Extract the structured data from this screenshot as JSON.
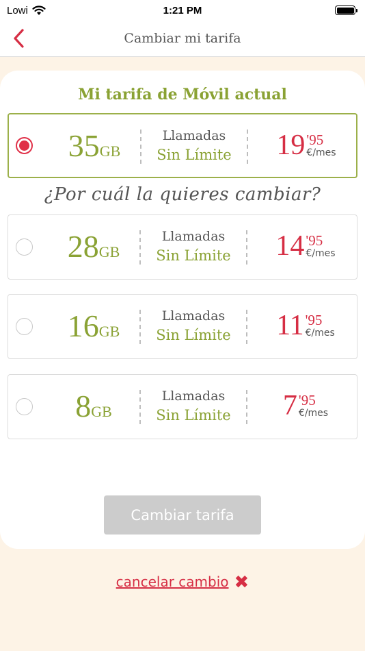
{
  "status_bar": {
    "carrier": "Lowi",
    "time": "1:21 PM"
  },
  "nav": {
    "title": "Cambiar mi tarifa"
  },
  "current_section_title": "Mi tarifa de Móvil actual",
  "question": "¿Por cuál la quieres cambiar?",
  "plans": [
    {
      "gb": "35",
      "gb_unit": "GB",
      "calls_line1": "Llamadas",
      "calls_line2": "Sin Límite",
      "price_int": "19",
      "price_cents": "'95",
      "price_period": "€/mes",
      "selected": true
    },
    {
      "gb": "28",
      "gb_unit": "GB",
      "calls_line1": "Llamadas",
      "calls_line2": "Sin Límite",
      "price_int": "14",
      "price_cents": "'95",
      "price_period": "€/mes",
      "selected": false
    },
    {
      "gb": "16",
      "gb_unit": "GB",
      "calls_line1": "Llamadas",
      "calls_line2": "Sin Límite",
      "price_int": "11",
      "price_cents": "'95",
      "price_period": "€/mes",
      "selected": false
    },
    {
      "gb": "8",
      "gb_unit": "GB",
      "calls_line1": "Llamadas",
      "calls_line2": "Sin Límite",
      "price_int": "7",
      "price_cents": "'95",
      "price_period": "€/mes",
      "selected": false
    }
  ],
  "submit_label": "Cambiar tarifa",
  "cancel_label": "cancelar cambio",
  "colors": {
    "accent_green": "#8aa234",
    "accent_red": "#d62e44",
    "background": "#fdf3e6"
  }
}
